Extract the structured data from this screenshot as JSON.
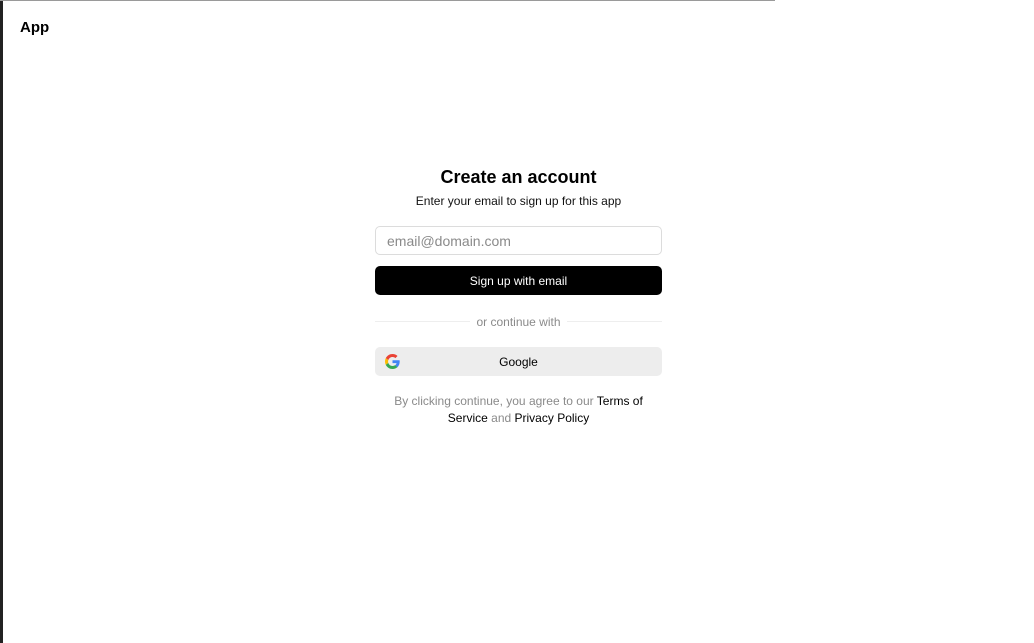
{
  "app": {
    "title": "App"
  },
  "signup": {
    "heading": "Create an account",
    "subheading": "Enter your email to sign up for this app",
    "email_placeholder": "email@domain.com",
    "email_value": "",
    "submit_label": "Sign up with email",
    "divider_text": "or continue with",
    "google_label": "Google",
    "google_icon": "google-icon"
  },
  "legal": {
    "prefix": "By clicking continue, you agree to our ",
    "terms_link": "Terms of Service",
    "conjunction": " and ",
    "privacy_link": "Privacy Policy"
  },
  "colors": {
    "primary_button": "#000000",
    "secondary_button": "#ededed",
    "muted_text": "#8a8a8a"
  }
}
